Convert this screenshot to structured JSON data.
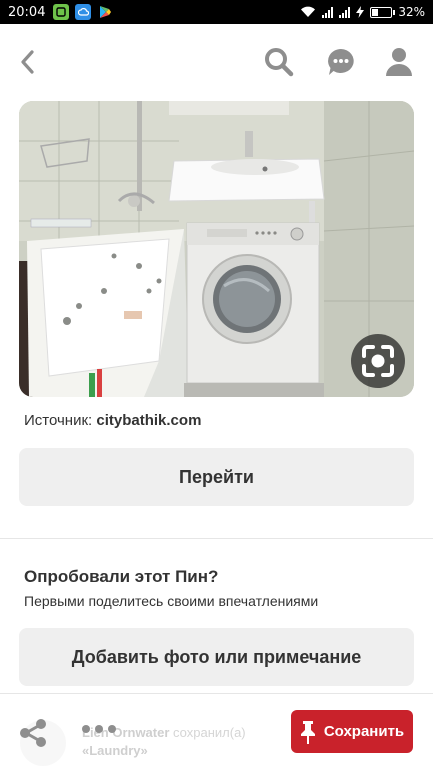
{
  "status_bar": {
    "time": "20:04",
    "battery": "32%",
    "notification_icons": [
      "messages-icon",
      "cloud-icon",
      "play-store-icon"
    ]
  },
  "header": {
    "icons": [
      "back-icon",
      "search-icon",
      "chat-icon",
      "profile-icon"
    ]
  },
  "pin": {
    "image_alt": "bathroom with washing machine under sink",
    "source_prefix": "Источник: ",
    "source_domain": "citybathik.com",
    "go_label": "Перейти"
  },
  "tried": {
    "title": "Опробовали этот Пин?",
    "subtitle": "Первыми поделитесь своими впечатлениями",
    "add_label": "Добавить фото или примечание"
  },
  "bottom_bar": {
    "ghost_line1_name": "Lien Ornwater",
    "ghost_line1_rest": " сохранил(а)",
    "ghost_line2": "«Laundry»",
    "save_label": "Сохранить"
  },
  "colors": {
    "accent": "#c9222b",
    "button_gray": "#efefef",
    "text": "#333333"
  }
}
